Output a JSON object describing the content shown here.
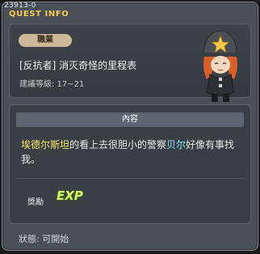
{
  "window": {
    "quest_id": "23913-0",
    "title": "QUEST INFO"
  },
  "header": {
    "job_badge": "職業",
    "quest_title": "[反抗者] 消灭奇怪的里程表",
    "level_text": "建議等級: 17~21"
  },
  "content": {
    "heading": "內容",
    "description": {
      "npc1": "埃德尔斯坦",
      "text1": "的看上去很胆小的警察",
      "npc2": "贝尔",
      "text2": "好像有事找我。"
    },
    "reward_label": "獎勵",
    "reward_icon": "EXP"
  },
  "footer": {
    "status_text": "狀態: 可開始"
  },
  "colors": {
    "accent_title": "#f2c94c",
    "npc_highlight_1": "#f6e66b",
    "npc_highlight_2": "#7fe8ff"
  },
  "icons": {
    "npc": "police-girl-portrait",
    "reward": "exp-icon"
  }
}
